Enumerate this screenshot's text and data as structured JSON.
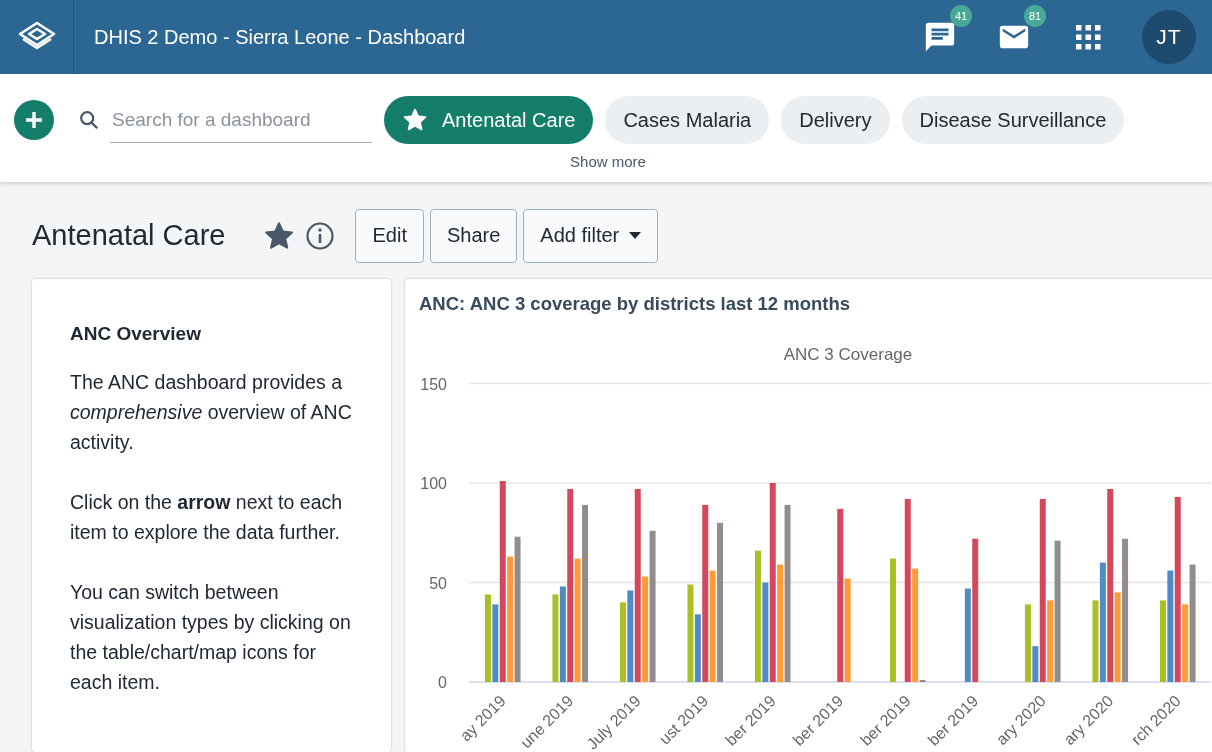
{
  "header": {
    "title": "DHIS 2 Demo - Sierra Leone - Dashboard",
    "messages": {
      "count": "41"
    },
    "mail": {
      "count": "81"
    },
    "avatar": "JT"
  },
  "toolbar": {
    "search": {
      "placeholder": "Search for a dashboard"
    },
    "chips": [
      {
        "label": "Antenatal Care",
        "selected": true,
        "starred": true
      },
      {
        "label": "Cases Malaria",
        "selected": false,
        "starred": false
      },
      {
        "label": "Delivery",
        "selected": false,
        "starred": false
      },
      {
        "label": "Disease Surveillance",
        "selected": false,
        "starred": false
      }
    ],
    "show_more": "Show more"
  },
  "dashboard": {
    "title": "Antenatal Care",
    "starred": true,
    "buttons": [
      {
        "label": "Edit",
        "kind": "plain"
      },
      {
        "label": "Share",
        "kind": "plain"
      },
      {
        "label": "Add filter",
        "kind": "dropdown"
      }
    ]
  },
  "text_item": {
    "heading": "ANC Overview",
    "paragraphs": [
      "The ANC dashboard provides a *comprehensive* overview of ANC activity.",
      "Click on the **arrow** next to each item to explore the data further.",
      "You can switch between visualization types by clicking on the table/chart/map icons for each item."
    ]
  },
  "chart_item": {
    "title": "ANC: ANC 3 coverage by districts last 12 months",
    "chart_data": {
      "type": "bar",
      "title": "ANC 3 Coverage",
      "categories": [
        "ay 2019",
        "une 2019",
        "July 2019",
        "ust 2019",
        "ber 2019",
        "ber 2019",
        "ber 2019",
        "ber 2019",
        "ary 2020",
        "ary 2020",
        "rch 2020"
      ],
      "series": [
        {
          "color": "#a9bf24",
          "values": [
            44,
            44,
            40,
            49,
            66,
            null,
            62,
            null,
            39,
            41,
            41
          ]
        },
        {
          "color": "#508cc3",
          "values": [
            39,
            48,
            46,
            34,
            50,
            null,
            null,
            47,
            18,
            60,
            56
          ]
        },
        {
          "color": "#d5485b",
          "values": [
            101,
            97,
            97,
            89,
            100,
            87,
            92,
            72,
            92,
            97,
            93
          ]
        },
        {
          "color": "#fd9b37",
          "values": [
            63,
            62,
            53,
            56,
            59,
            52,
            57,
            null,
            41,
            45,
            39
          ]
        },
        {
          "color": "#938c8c",
          "values": [
            73,
            89,
            76,
            80,
            89,
            null,
            1,
            null,
            71,
            72,
            59
          ]
        }
      ],
      "ylim": [
        0,
        150
      ],
      "yticks": [
        0,
        50,
        100,
        150
      ]
    }
  }
}
